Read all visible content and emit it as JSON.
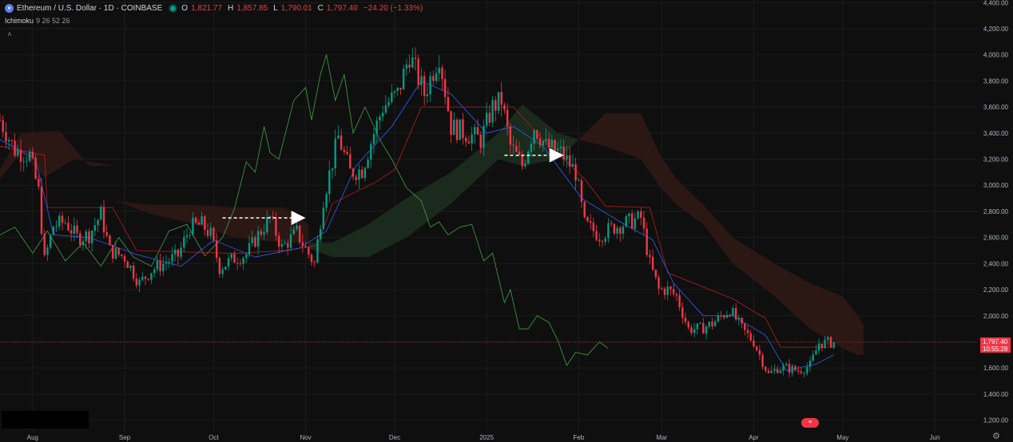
{
  "header": {
    "symbol_title": "Ethereum / U.S. Dollar · 1D · COINBASE",
    "ohlc": [
      {
        "key": "O",
        "value": "1,821.77"
      },
      {
        "key": "H",
        "value": "1,857.85"
      },
      {
        "key": "L",
        "value": "1,790.01"
      },
      {
        "key": "C",
        "value": "1,797.40"
      }
    ],
    "change": "−24.20 (−1.33%)",
    "icon": "ethereum-icon"
  },
  "indicator": {
    "name": "Ichimoku",
    "params": "9 26 52 26"
  },
  "collapse_icon": "chevron-up-icon",
  "price_badge": {
    "price": "1,797.40",
    "countdown": "10:55:28"
  },
  "flag_button": {
    "icon": "us-flag-icon"
  },
  "settings_icon": "gear-icon",
  "colors": {
    "up": "#089981",
    "down": "#f23645",
    "tenkan": "#2962ff",
    "kijun": "#b71c1c",
    "chikou": "#43a047",
    "cloud_bear": "#2b1714",
    "cloud_bull": "#1a2a1c",
    "annotation": "#ffffff"
  },
  "chart_data": {
    "type": "candlestick",
    "symbol": "Ethereum / U.S. Dollar",
    "interval": "1D",
    "exchange": "COINBASE",
    "ylim": [
      1100,
      4420
    ],
    "y_ticks": [
      1200,
      1400,
      1600,
      1800,
      2000,
      2200,
      2400,
      2600,
      2800,
      3000,
      3200,
      3400,
      3600,
      3800,
      4000,
      4200,
      4400
    ],
    "y_tick_labels": [
      "1,200.00",
      "1,400.00",
      "1,600.00",
      "1,800.00",
      "2,000.00",
      "2,200.00",
      "2,400.00",
      "2,600.00",
      "2,800.00",
      "3,000.00",
      "3,200.00",
      "3,400.00",
      "3,600.00",
      "3,800.00",
      "4,000.00",
      "4,200.00",
      "4,400.00"
    ],
    "x_ticks": [
      {
        "label": "Aug",
        "date": "2024-08-01"
      },
      {
        "label": "Sep",
        "date": "2024-09-01"
      },
      {
        "label": "Oct",
        "date": "2024-10-01"
      },
      {
        "label": "Nov",
        "date": "2024-11-01"
      },
      {
        "label": "Dec",
        "date": "2024-12-01"
      },
      {
        "label": "2025",
        "date": "2025-01-01"
      },
      {
        "label": "Feb",
        "date": "2025-02-01"
      },
      {
        "label": "Mar",
        "date": "2025-03-01"
      },
      {
        "label": "Apr",
        "date": "2025-04-01"
      },
      {
        "label": "May",
        "date": "2025-05-01"
      },
      {
        "label": "Jun",
        "date": "2025-06-01"
      }
    ],
    "x_range": [
      "2024-07-21",
      "2025-06-15"
    ],
    "close_path": [
      [
        "2024-07-21",
        3500
      ],
      [
        "2024-07-26",
        3270
      ],
      [
        "2024-07-31",
        3230
      ],
      [
        "2024-08-03",
        2950
      ],
      [
        "2024-08-05",
        2420
      ],
      [
        "2024-08-08",
        2690
      ],
      [
        "2024-08-12",
        2720
      ],
      [
        "2024-08-16",
        2600
      ],
      [
        "2024-08-20",
        2620
      ],
      [
        "2024-08-24",
        2780
      ],
      [
        "2024-08-27",
        2500
      ],
      [
        "2024-09-01",
        2450
      ],
      [
        "2024-09-06",
        2250
      ],
      [
        "2024-09-10",
        2350
      ],
      [
        "2024-09-14",
        2400
      ],
      [
        "2024-09-19",
        2460
      ],
      [
        "2024-09-23",
        2680
      ],
      [
        "2024-09-27",
        2700
      ],
      [
        "2024-09-30",
        2620
      ],
      [
        "2024-10-03",
        2370
      ],
      [
        "2024-10-08",
        2440
      ],
      [
        "2024-10-12",
        2470
      ],
      [
        "2024-10-16",
        2620
      ],
      [
        "2024-10-20",
        2750
      ],
      [
        "2024-10-24",
        2520
      ],
      [
        "2024-10-29",
        2640
      ],
      [
        "2024-11-01",
        2510
      ],
      [
        "2024-11-04",
        2400
      ],
      [
        "2024-11-07",
        2900
      ],
      [
        "2024-11-12",
        3370
      ],
      [
        "2024-11-16",
        3100
      ],
      [
        "2024-11-20",
        3120
      ],
      [
        "2024-11-24",
        3400
      ],
      [
        "2024-11-27",
        3600
      ],
      [
        "2024-12-02",
        3700
      ],
      [
        "2024-12-06",
        4000
      ],
      [
        "2024-12-11",
        3700
      ],
      [
        "2024-12-16",
        4000
      ],
      [
        "2024-12-20",
        3450
      ],
      [
        "2024-12-25",
        3400
      ],
      [
        "2024-12-30",
        3350
      ],
      [
        "2025-01-03",
        3600
      ],
      [
        "2025-01-06",
        3650
      ],
      [
        "2025-01-09",
        3300
      ],
      [
        "2025-01-13",
        3150
      ],
      [
        "2025-01-17",
        3450
      ],
      [
        "2025-01-21",
        3300
      ],
      [
        "2025-01-26",
        3250
      ],
      [
        "2025-01-31",
        3100
      ],
      [
        "2025-02-03",
        2700
      ],
      [
        "2025-02-08",
        2620
      ],
      [
        "2025-02-13",
        2680
      ],
      [
        "2025-02-18",
        2720
      ],
      [
        "2025-02-22",
        2750
      ],
      [
        "2025-02-25",
        2400
      ],
      [
        "2025-02-28",
        2200
      ],
      [
        "2025-03-03",
        2200
      ],
      [
        "2025-03-06",
        2150
      ],
      [
        "2025-03-10",
        1900
      ],
      [
        "2025-03-14",
        1900
      ],
      [
        "2025-03-18",
        1940
      ],
      [
        "2025-03-24",
        2050
      ],
      [
        "2025-03-28",
        1900
      ],
      [
        "2025-04-01",
        1800
      ],
      [
        "2025-04-06",
        1550
      ],
      [
        "2025-04-09",
        1600
      ],
      [
        "2025-04-12",
        1600
      ],
      [
        "2025-04-16",
        1580
      ],
      [
        "2025-04-20",
        1620
      ],
      [
        "2025-04-23",
        1790
      ],
      [
        "2025-04-28",
        1797.4
      ]
    ],
    "tenkan_path": [
      [
        "2024-07-21",
        3350
      ],
      [
        "2024-08-02",
        3200
      ],
      [
        "2024-08-08",
        2620
      ],
      [
        "2024-08-20",
        2600
      ],
      [
        "2024-09-05",
        2470
      ],
      [
        "2024-09-20",
        2380
      ],
      [
        "2024-10-01",
        2580
      ],
      [
        "2024-10-15",
        2450
      ],
      [
        "2024-10-30",
        2520
      ],
      [
        "2024-11-08",
        2650
      ],
      [
        "2024-11-18",
        3150
      ],
      [
        "2024-11-30",
        3450
      ],
      [
        "2024-12-10",
        3800
      ],
      [
        "2024-12-20",
        3700
      ],
      [
        "2025-01-01",
        3400
      ],
      [
        "2025-01-10",
        3450
      ],
      [
        "2025-01-20",
        3300
      ],
      [
        "2025-02-02",
        2900
      ],
      [
        "2025-02-15",
        2720
      ],
      [
        "2025-02-26",
        2580
      ],
      [
        "2025-03-05",
        2250
      ],
      [
        "2025-03-15",
        2000
      ],
      [
        "2025-03-25",
        2000
      ],
      [
        "2025-04-05",
        1850
      ],
      [
        "2025-04-12",
        1580
      ],
      [
        "2025-04-22",
        1630
      ],
      [
        "2025-04-28",
        1700
      ]
    ],
    "kijun_path": [
      [
        "2024-07-21",
        3300
      ],
      [
        "2024-08-05",
        3230
      ],
      [
        "2024-08-06",
        2830
      ],
      [
        "2024-08-28",
        2830
      ],
      [
        "2024-09-05",
        2500
      ],
      [
        "2024-10-05",
        2480
      ],
      [
        "2024-10-10",
        2480
      ],
      [
        "2024-10-25",
        2500
      ],
      [
        "2024-11-05",
        2540
      ],
      [
        "2024-11-10",
        2860
      ],
      [
        "2024-11-25",
        3030
      ],
      [
        "2024-12-01",
        3120
      ],
      [
        "2024-12-10",
        3600
      ],
      [
        "2025-01-10",
        3600
      ],
      [
        "2025-01-20",
        3350
      ],
      [
        "2025-02-03",
        3050
      ],
      [
        "2025-02-10",
        2840
      ],
      [
        "2025-02-25",
        2830
      ],
      [
        "2025-03-03",
        2330
      ],
      [
        "2025-03-25",
        2130
      ],
      [
        "2025-04-05",
        1980
      ],
      [
        "2025-04-10",
        1760
      ],
      [
        "2025-04-25",
        1760
      ],
      [
        "2025-04-28",
        1760
      ]
    ],
    "chikou_path": [
      [
        "2024-07-21",
        2620
      ],
      [
        "2024-07-26",
        2680
      ],
      [
        "2024-08-01",
        2480
      ],
      [
        "2024-08-06",
        2650
      ],
      [
        "2024-08-12",
        2420
      ],
      [
        "2024-08-18",
        2560
      ],
      [
        "2024-08-24",
        2380
      ],
      [
        "2024-08-30",
        2600
      ],
      [
        "2024-09-04",
        2450
      ],
      [
        "2024-09-10",
        2380
      ],
      [
        "2024-09-16",
        2650
      ],
      [
        "2024-09-22",
        2700
      ],
      [
        "2024-09-28",
        2460
      ],
      [
        "2024-10-04",
        2600
      ],
      [
        "2024-10-08",
        2820
      ],
      [
        "2024-10-12",
        3180
      ],
      [
        "2024-10-15",
        3100
      ],
      [
        "2024-10-18",
        3450
      ],
      [
        "2024-10-20",
        3250
      ],
      [
        "2024-10-23",
        3200
      ],
      [
        "2024-10-28",
        3650
      ],
      [
        "2024-11-01",
        3750
      ],
      [
        "2024-11-03",
        3500
      ],
      [
        "2024-11-06",
        3850
      ],
      [
        "2024-11-08",
        4000
      ],
      [
        "2024-11-11",
        3650
      ],
      [
        "2024-11-14",
        3850
      ],
      [
        "2024-11-17",
        3400
      ],
      [
        "2024-11-21",
        3600
      ],
      [
        "2024-11-26",
        3350
      ],
      [
        "2024-11-30",
        3200
      ],
      [
        "2024-12-05",
        2980
      ],
      [
        "2024-12-10",
        2880
      ],
      [
        "2024-12-13",
        2680
      ],
      [
        "2024-12-16",
        2720
      ],
      [
        "2024-12-19",
        2620
      ],
      [
        "2024-12-23",
        2680
      ],
      [
        "2024-12-27",
        2700
      ],
      [
        "2024-12-31",
        2420
      ],
      [
        "2025-01-03",
        2480
      ],
      [
        "2025-01-07",
        2100
      ],
      [
        "2025-01-09",
        2200
      ],
      [
        "2025-01-12",
        1900
      ],
      [
        "2025-01-15",
        1900
      ],
      [
        "2025-01-18",
        2000
      ],
      [
        "2025-01-22",
        1950
      ],
      [
        "2025-01-25",
        1810
      ],
      [
        "2025-01-28",
        1620
      ],
      [
        "2025-01-31",
        1720
      ],
      [
        "2025-02-04",
        1700
      ],
      [
        "2025-02-08",
        1800
      ],
      [
        "2025-02-11",
        1750
      ]
    ],
    "cloud_segments": [
      {
        "sentiment": "bearish",
        "top": [
          [
            "2024-07-21",
            3120
          ],
          [
            "2024-07-28",
            3400
          ],
          [
            "2024-08-10",
            3420
          ],
          [
            "2024-08-20",
            3150
          ],
          [
            "2024-08-29",
            3150
          ]
        ],
        "bottom": [
          [
            "2024-07-21",
            3050
          ],
          [
            "2024-07-28",
            3250
          ],
          [
            "2024-08-05",
            3060
          ],
          [
            "2024-08-15",
            3200
          ],
          [
            "2024-08-29",
            3150
          ]
        ]
      },
      {
        "sentiment": "bearish",
        "top": [
          [
            "2024-08-29",
            2880
          ],
          [
            "2024-09-10",
            2850
          ],
          [
            "2024-09-25",
            2850
          ],
          [
            "2024-10-08",
            2830
          ],
          [
            "2024-10-25",
            2830
          ],
          [
            "2024-11-02",
            2700
          ]
        ],
        "bottom": [
          [
            "2024-08-29",
            2880
          ],
          [
            "2024-09-10",
            2780
          ],
          [
            "2024-09-25",
            2700
          ],
          [
            "2024-10-08",
            2600
          ],
          [
            "2024-10-25",
            2560
          ],
          [
            "2024-11-02",
            2560
          ]
        ]
      },
      {
        "sentiment": "bullish",
        "top": [
          [
            "2024-11-02",
            2560
          ],
          [
            "2024-11-10",
            2560
          ],
          [
            "2024-11-22",
            2700
          ],
          [
            "2024-12-05",
            2900
          ],
          [
            "2024-12-20",
            3100
          ],
          [
            "2025-01-05",
            3400
          ],
          [
            "2025-01-13",
            3620
          ],
          [
            "2025-01-25",
            3400
          ],
          [
            "2025-02-01",
            3350
          ]
        ],
        "bottom": [
          [
            "2024-11-02",
            2520
          ],
          [
            "2024-11-10",
            2450
          ],
          [
            "2024-11-22",
            2450
          ],
          [
            "2024-12-05",
            2600
          ],
          [
            "2024-12-20",
            2860
          ],
          [
            "2025-01-05",
            3200
          ],
          [
            "2025-01-13",
            3150
          ],
          [
            "2025-01-25",
            3200
          ],
          [
            "2025-02-01",
            3350
          ]
        ]
      },
      {
        "sentiment": "bearish",
        "top": [
          [
            "2025-02-01",
            3350
          ],
          [
            "2025-02-10",
            3550
          ],
          [
            "2025-02-22",
            3550
          ],
          [
            "2025-02-28",
            3250
          ],
          [
            "2025-03-06",
            3050
          ],
          [
            "2025-03-15",
            2850
          ],
          [
            "2025-03-25",
            2600
          ],
          [
            "2025-04-08",
            2400
          ],
          [
            "2025-04-20",
            2250
          ],
          [
            "2025-05-01",
            2150
          ],
          [
            "2025-05-06",
            2000
          ],
          [
            "2025-05-08",
            1930
          ]
        ],
        "bottom": [
          [
            "2025-02-01",
            3350
          ],
          [
            "2025-02-10",
            3300
          ],
          [
            "2025-02-22",
            3200
          ],
          [
            "2025-02-28",
            3000
          ],
          [
            "2025-03-06",
            2850
          ],
          [
            "2025-03-15",
            2700
          ],
          [
            "2025-03-25",
            2400
          ],
          [
            "2025-04-08",
            2150
          ],
          [
            "2025-04-20",
            1900
          ],
          [
            "2025-05-01",
            1750
          ],
          [
            "2025-05-06",
            1700
          ],
          [
            "2025-05-08",
            1700
          ]
        ]
      }
    ],
    "annotations": [
      {
        "type": "dashed-arrow",
        "from": [
          "2024-10-04",
          2750
        ],
        "to": [
          "2024-11-01",
          2750
        ]
      },
      {
        "type": "dashed-arrow",
        "from": [
          "2025-01-07",
          3230
        ],
        "to": [
          "2025-01-27",
          3230
        ]
      }
    ],
    "last_price": 1797.4
  }
}
